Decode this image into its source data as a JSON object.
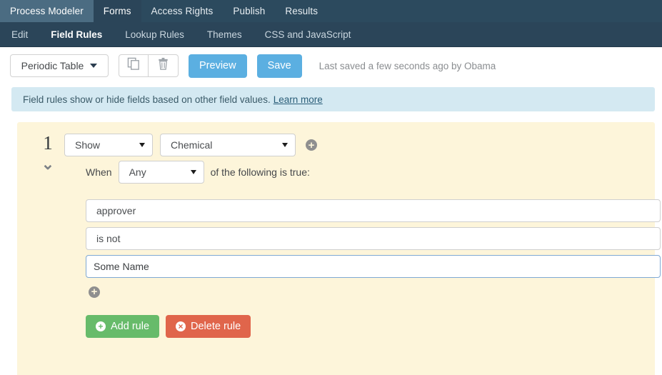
{
  "topnav": {
    "tabs": [
      {
        "label": "Process Modeler",
        "state": "highlight"
      },
      {
        "label": "Forms",
        "state": "active"
      },
      {
        "label": "Access Rights",
        "state": "normal"
      },
      {
        "label": "Publish",
        "state": "normal"
      },
      {
        "label": "Results",
        "state": "normal"
      }
    ]
  },
  "subnav": {
    "items": [
      {
        "label": "Edit",
        "active": false
      },
      {
        "label": "Field Rules",
        "active": true
      },
      {
        "label": "Lookup Rules",
        "active": false
      },
      {
        "label": "Themes",
        "active": false
      },
      {
        "label": "CSS and JavaScript",
        "active": false
      }
    ]
  },
  "toolbar": {
    "form_selector_value": "Periodic Table",
    "copy_icon": "copy-icon",
    "trash_icon": "trash-icon",
    "preview_label": "Preview",
    "save_label": "Save",
    "last_saved": "Last saved a few seconds ago by Obama"
  },
  "banner": {
    "text": "Field rules show or hide fields based on other field values.",
    "link_label": "Learn more",
    "background": "#d4e9f2"
  },
  "rule": {
    "number": "1",
    "action_value": "Show",
    "field_value": "Chemical",
    "add_field_icon": "plus-circle-icon",
    "collapse_icon": "chevron-down-icon",
    "when_prefix": "When",
    "match_value": "Any",
    "when_suffix": "of the following is true:",
    "conditions": [
      {
        "field_value": "approver",
        "operator_value": "is not",
        "input_value": "Some Name"
      }
    ],
    "add_condition_icon": "plus-circle-icon",
    "add_rule_label": "Add rule",
    "delete_rule_label": "Delete rule",
    "panel_background": "#fdf5da",
    "add_rule_color": "#67bb6a",
    "delete_rule_color": "#e0654b"
  }
}
